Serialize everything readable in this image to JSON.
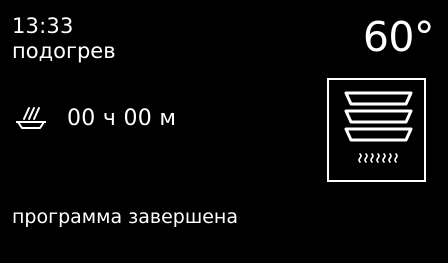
{
  "header": {
    "clock": "13:33",
    "mode": "подогрев",
    "temperature": "60°"
  },
  "timer": {
    "icon": "plate-warming-icon",
    "value": "00 ч 00 м"
  },
  "status": {
    "message": "программа завершена"
  },
  "oven": {
    "icon": "stacked-plates-bottom-heat-icon"
  },
  "colors": {
    "background": "#000000",
    "foreground": "#ffffff"
  }
}
